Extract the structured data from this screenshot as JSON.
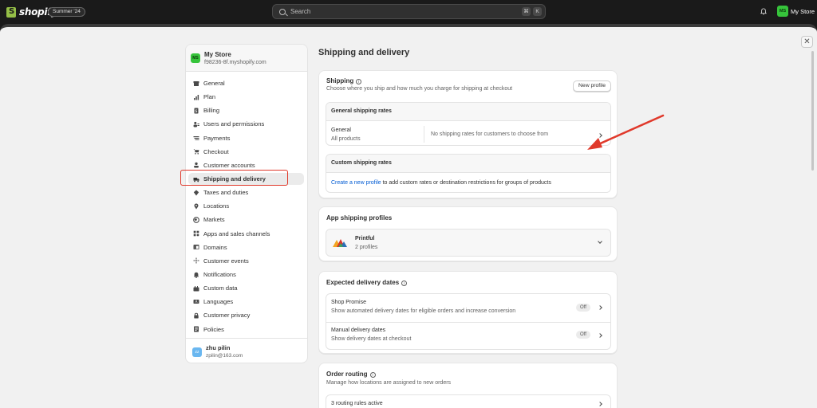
{
  "topbar": {
    "brand": "shopify",
    "edition": "Summer '24",
    "search_placeholder": "Search",
    "kbd_cmd": "⌘",
    "kbd_k": "K",
    "avatar_initials": "MS",
    "store_name": "My Store"
  },
  "sidebar": {
    "store_initials": "MS",
    "store_name": "My Store",
    "store_domain": "f98236-8f.myshopify.com",
    "items": [
      {
        "label": "General",
        "icon": "store-icon"
      },
      {
        "label": "Plan",
        "icon": "plan-icon"
      },
      {
        "label": "Billing",
        "icon": "billing-icon"
      },
      {
        "label": "Users and permissions",
        "icon": "users-icon"
      },
      {
        "label": "Payments",
        "icon": "payments-icon"
      },
      {
        "label": "Checkout",
        "icon": "cart-icon"
      },
      {
        "label": "Customer accounts",
        "icon": "person-icon"
      },
      {
        "label": "Shipping and delivery",
        "icon": "truck-icon"
      },
      {
        "label": "Taxes and duties",
        "icon": "tax-icon"
      },
      {
        "label": "Locations",
        "icon": "location-icon"
      },
      {
        "label": "Markets",
        "icon": "globe-icon"
      },
      {
        "label": "Apps and sales channels",
        "icon": "apps-icon"
      },
      {
        "label": "Domains",
        "icon": "domain-icon"
      },
      {
        "label": "Customer events",
        "icon": "events-icon"
      },
      {
        "label": "Notifications",
        "icon": "bell-icon"
      },
      {
        "label": "Custom data",
        "icon": "data-icon"
      },
      {
        "label": "Languages",
        "icon": "language-icon"
      },
      {
        "label": "Customer privacy",
        "icon": "lock-icon"
      },
      {
        "label": "Policies",
        "icon": "policy-icon"
      }
    ],
    "user_initials": "zz",
    "user_name": "zhu pilin",
    "user_email": "zpilin@163.com"
  },
  "main": {
    "title": "Shipping and delivery",
    "shipping": {
      "title": "Shipping",
      "subtitle": "Choose where you ship and how much you charge for shipping at checkout",
      "new_profile": "New profile",
      "general_rates_header": "General shipping rates",
      "general_title": "General",
      "general_sub": "All products",
      "general_status": "No shipping rates for customers to choose from",
      "custom_rates_header": "Custom shipping rates",
      "custom_link": "Create a new profile",
      "custom_rest": " to add custom rates or destination restrictions for groups of products"
    },
    "app_profiles": {
      "title": "App shipping profiles",
      "app_name": "Printful",
      "app_sub": "2 profiles"
    },
    "delivery_dates": {
      "title": "Expected delivery dates",
      "rows": [
        {
          "title": "Shop Promise",
          "sub": "Show automated delivery dates for eligible orders and increase conversion",
          "status": "Off"
        },
        {
          "title": "Manual delivery dates",
          "sub": "Show delivery dates at checkout",
          "status": "Off"
        }
      ]
    },
    "order_routing": {
      "title": "Order routing",
      "subtitle": "Manage how locations are assigned to new orders",
      "row": "3 routing rules active"
    }
  },
  "colors": {
    "accent_green": "#36c43b",
    "highlight_red": "#e0392b",
    "link_blue": "#005bd3"
  }
}
